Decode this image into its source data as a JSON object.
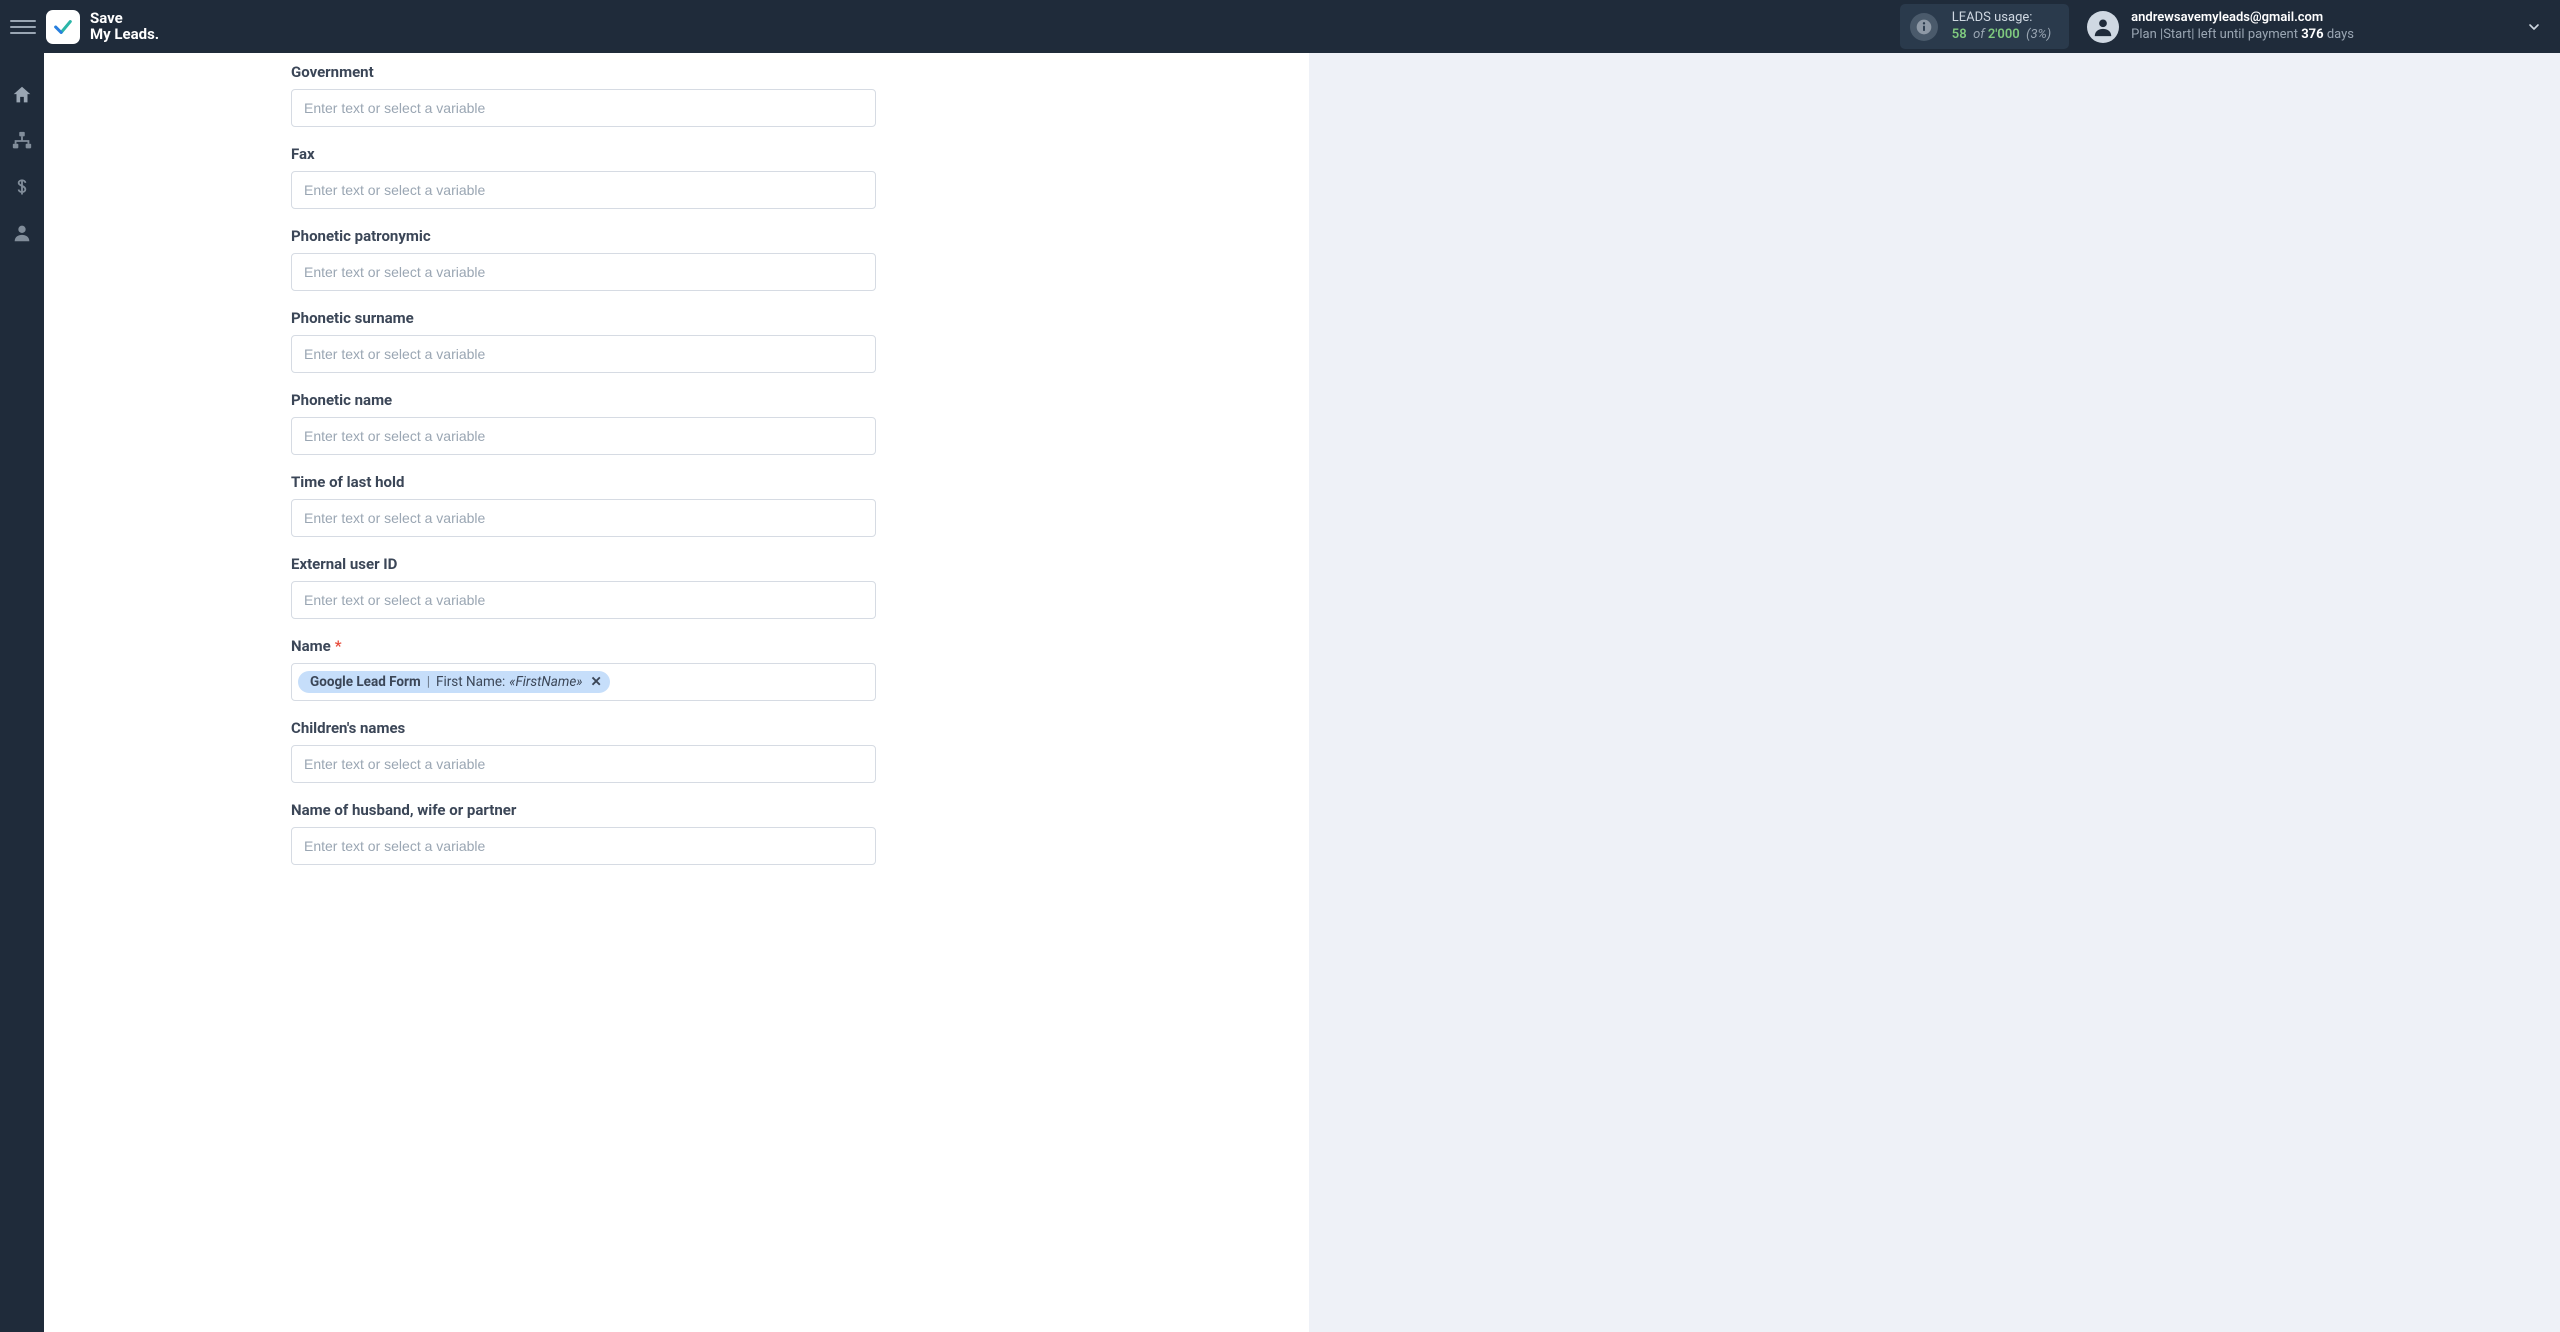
{
  "brand": {
    "name_line1": "Save",
    "name_line2": "My Leads."
  },
  "usage": {
    "title": "LEADS usage:",
    "count": "58",
    "of": "of",
    "total": "2'000",
    "pct": "(3%)"
  },
  "account": {
    "email": "andrewsavemyleads@gmail.com",
    "plan_prefix": "Plan |",
    "plan_name": "Start",
    "plan_mid": "| left until payment ",
    "days": "376",
    "days_suffix": " days"
  },
  "placeholder": "Enter text or select a variable",
  "fields": [
    {
      "label": "Government",
      "required": false,
      "type": "text"
    },
    {
      "label": "Fax",
      "required": false,
      "type": "text"
    },
    {
      "label": "Phonetic patronymic",
      "required": false,
      "type": "text"
    },
    {
      "label": "Phonetic surname",
      "required": false,
      "type": "text"
    },
    {
      "label": "Phonetic name",
      "required": false,
      "type": "text"
    },
    {
      "label": "Time of last hold",
      "required": false,
      "type": "text"
    },
    {
      "label": "External user ID",
      "required": false,
      "type": "text"
    },
    {
      "label": "Name",
      "required": true,
      "type": "chip",
      "chip": {
        "source": "Google Lead Form",
        "field": "First Name:",
        "value": "«FirstName»"
      }
    },
    {
      "label": "Children's names",
      "required": false,
      "type": "text"
    },
    {
      "label": "Name of husband, wife or partner",
      "required": false,
      "type": "text"
    }
  ]
}
